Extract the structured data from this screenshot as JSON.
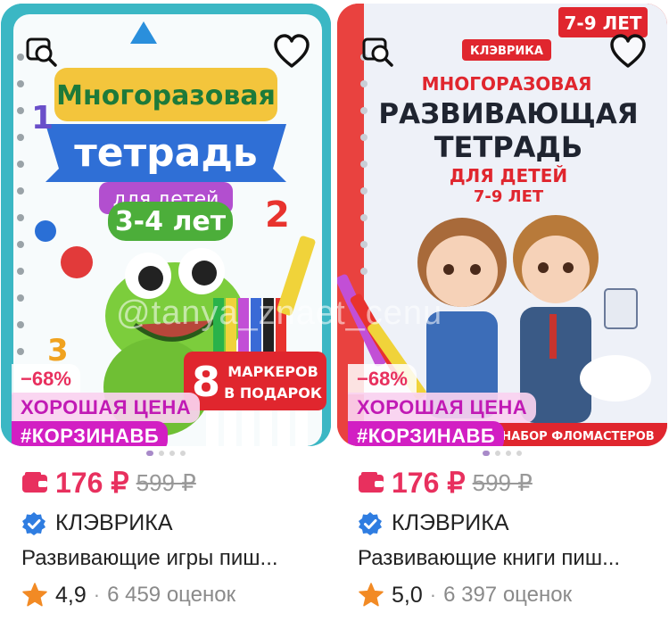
{
  "cards": [
    {
      "cover": {
        "line1": "Многоразовая",
        "line2": "тетрадь",
        "line3": "для детей",
        "line4": "3-4 лет",
        "promo_big": "8",
        "promo_text1": "МАРКЕРОВ",
        "promo_text2": "В ПОДАРОК",
        "num1": "1",
        "num2": "2",
        "num3": "3"
      },
      "discount": "−68%",
      "good_price": "ХОРОШАЯ ЦЕНА",
      "hashtag": "#КОРЗИНАВБ",
      "price": "176 ₽",
      "old_price": "599 ₽",
      "brand": "КЛЭВРИКА",
      "title": "Развивающие игры пиш...",
      "rating": "4,9",
      "separator": "·",
      "reviews": "6 459 оценок"
    },
    {
      "cover": {
        "age_badge": "7-9 ЛЕТ",
        "brand_label": "КЛЭВРИКА",
        "line1": "МНОГОРАЗОВАЯ",
        "line2": "РАЗВИВАЮЩАЯ",
        "line3": "ТЕТРАДЬ",
        "line4": "ДЛЯ ДЕТЕЙ",
        "line5": "7-9 ЛЕТ",
        "bottom_text": "НАБОР ФЛОМАСТЕРОВ"
      },
      "discount": "−68%",
      "good_price": "ХОРОШАЯ ЦЕНА",
      "hashtag": "#КОРЗИНАВБ",
      "price": "176 ₽",
      "old_price": "599 ₽",
      "brand": "КЛЭВРИКА",
      "title": "Развивающие книги пиш...",
      "rating": "5,0",
      "separator": "·",
      "reviews": "6 397 оценок"
    }
  ],
  "watermark": "@tanya_znaet_cenu",
  "colors": {
    "price": "#e8305e",
    "tag": "#d21fc3",
    "star": "#f28a24",
    "verified": "#2f7de1"
  },
  "icons": [
    "similar-search-icon",
    "heart-icon",
    "wallet-icon",
    "verified-icon",
    "star-icon"
  ]
}
